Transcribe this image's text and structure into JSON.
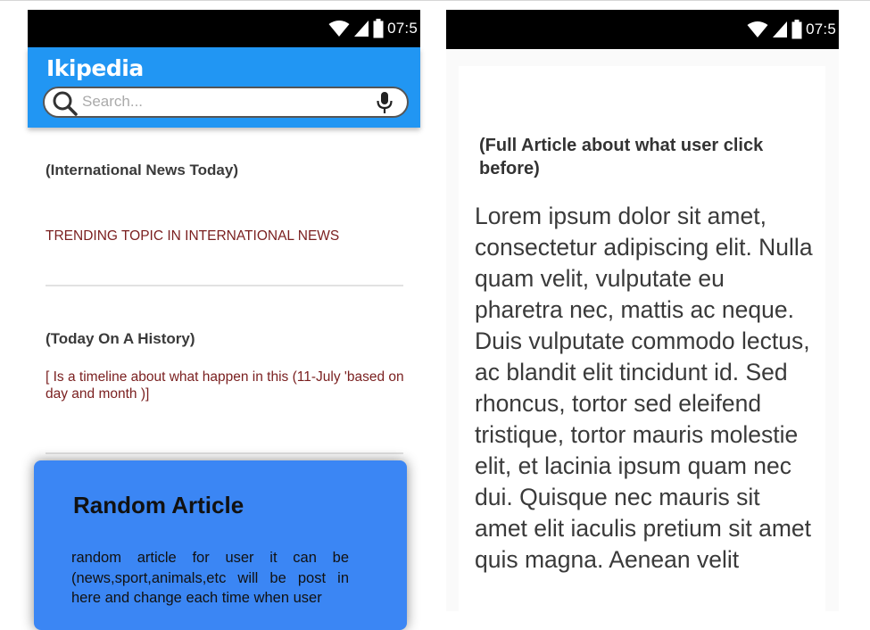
{
  "status_bar": {
    "time": "07:5"
  },
  "app": {
    "title": "Ikipedia",
    "search_placeholder": "Search..."
  },
  "home": {
    "international_title": "(International News Today)",
    "trending_link": "TRENDING TOPIC IN INTERNATIONAL NEWS",
    "history_title": "(Today On A History)",
    "history_text": "[ Is a timeline about what happen in this (11-July 'based on day and month )]",
    "random_title": "Random Article",
    "random_text": "random article for user it can be (news,sport,animals,etc will be post in here and change each time when user"
  },
  "article": {
    "heading": "(Full Article about what user click before)",
    "body": " Lorem ipsum dolor sit amet, consectetur adipiscing elit. Nulla quam velit, vulputate eu pharetra nec, mattis ac neque. Duis vulputate commodo lectus, ac blandit elit tincidunt id. Sed rhoncus, tortor sed eleifend tristique, tortor mauris molestie elit, et lacinia ipsum quam nec dui. Quisque nec mauris sit amet elit iaculis pretium sit amet quis magna. Aenean velit"
  },
  "colors": {
    "app_bar": "#2196f3",
    "random_card": "#3b86f4",
    "link_text": "#7a1f1f",
    "status_bar": "#000000"
  },
  "icons": [
    "wifi-icon",
    "cell-signal-icon",
    "battery-icon",
    "search-icon",
    "microphone-icon"
  ]
}
